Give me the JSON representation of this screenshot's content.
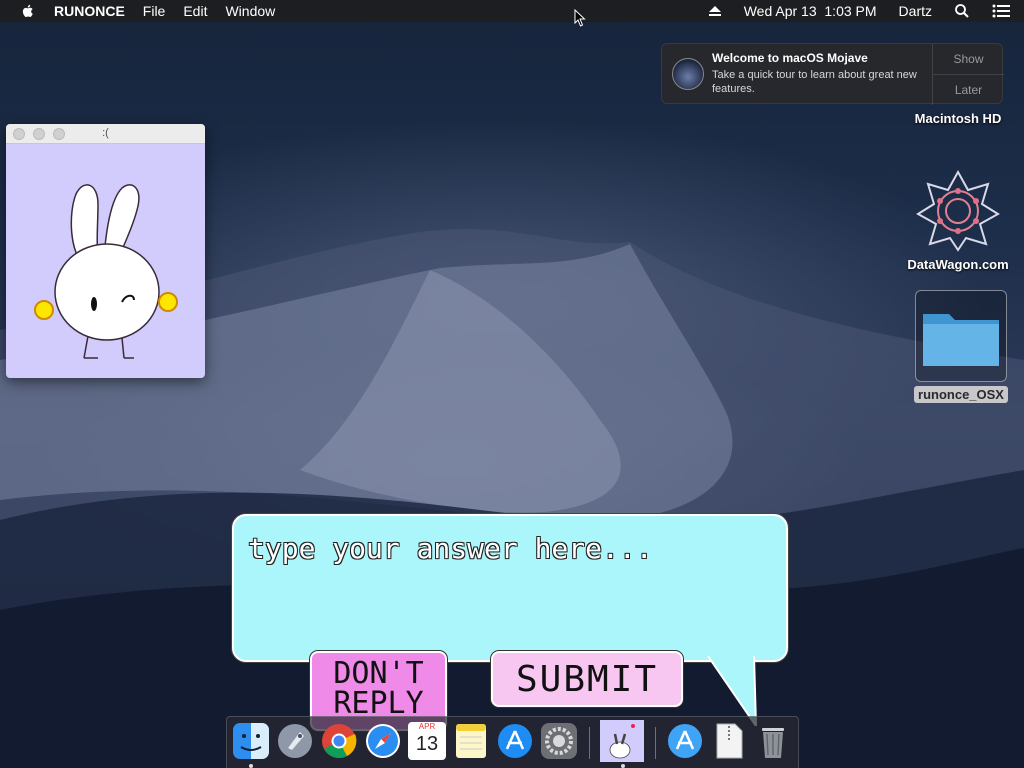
{
  "menubar": {
    "app_name": "RUNONCE",
    "menus": [
      "File",
      "Edit",
      "Window"
    ],
    "datetime": "Wed Apr 13  1:03 PM",
    "user": "Dartz"
  },
  "notification": {
    "title": "Welcome to macOS Mojave",
    "body": "Take a quick tour to learn about great new features.",
    "show_label": "Show",
    "later_label": "Later"
  },
  "desktop": {
    "icons": [
      {
        "label": "Macintosh HD",
        "icon": "hard-drive-icon"
      },
      {
        "label": "DataWagon.com",
        "icon": "datawagon-logo-icon"
      },
      {
        "label": "runonce_OSX",
        "icon": "folder-icon"
      }
    ]
  },
  "bunny_window": {
    "title": ":(",
    "background": "#d1ccfb"
  },
  "answer_prompt": {
    "placeholder": "type your answer here...",
    "dont_reply_label": "DON'T REPLY",
    "submit_label": "SUBMIT",
    "bubble_color": "#aaf6fb",
    "dont_reply_color": "#f08ae8",
    "submit_color": "#f7c6f1"
  },
  "dock": {
    "apps": [
      "finder",
      "launchpad",
      "chrome",
      "safari",
      "calendar",
      "notes",
      "app-store",
      "system-preferences",
      "runonce",
      "app-store-downloads",
      "zip-archive",
      "trash"
    ],
    "calendar": {
      "month": "APR",
      "day": "13"
    }
  }
}
